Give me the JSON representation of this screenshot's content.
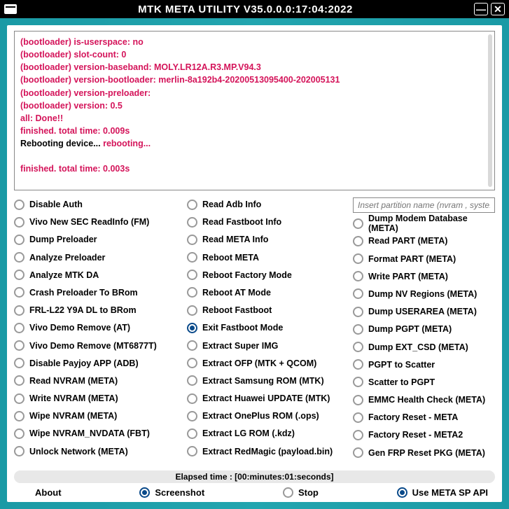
{
  "titlebar": {
    "title": "MTK META UTILITY V35.0.0.0:17:04:2022"
  },
  "log": {
    "lines": [
      {
        "cls": "log-red",
        "text": "(bootloader) is-userspace: no"
      },
      {
        "cls": "log-red",
        "text": "(bootloader) slot-count: 0"
      },
      {
        "cls": "log-red",
        "text": "(bootloader) version-baseband: MOLY.LR12A.R3.MP.V94.3"
      },
      {
        "cls": "log-red",
        "text": "(bootloader) version-bootloader: merlin-8a192b4-20200513095400-202005131"
      },
      {
        "cls": "log-red",
        "text": "(bootloader) version-preloader:"
      },
      {
        "cls": "log-red",
        "text": "(bootloader) version: 0.5"
      },
      {
        "cls": "log-red",
        "text": "all: Done!!"
      },
      {
        "cls": "log-red",
        "text": "finished. total time: 0.009s"
      },
      {
        "cls": "log-black",
        "prefix": "Rebooting device... ",
        "suffix_cls": "log-red",
        "suffix": "rebooting..."
      },
      {
        "cls": "",
        "text": " "
      },
      {
        "cls": "log-red",
        "text": "finished. total time: 0.003s"
      }
    ]
  },
  "input": {
    "placeholder": "Insert partition name (nvram , syste..."
  },
  "cols": {
    "c1": [
      "Disable Auth",
      "Vivo New SEC ReadInfo (FM)",
      "Dump Preloader",
      "Analyze Preloader",
      "Analyze MTK DA",
      "Crash Preloader To BRom",
      "FRL-L22 Y9A DL to BRom",
      "Vivo Demo Remove (AT)",
      "Vivo Demo Remove (MT6877T)",
      "Disable Payjoy APP (ADB)",
      "Read NVRAM (META)",
      "Write NVRAM (META)",
      "Wipe NVRAM (META)",
      "Wipe NVRAM_NVDATA (FBT)",
      "Unlock Network (META)"
    ],
    "c2": [
      "Read Adb Info",
      "Read Fastboot Info",
      "Read META Info",
      "Reboot META",
      "Reboot Factory Mode",
      "Reboot AT Mode",
      "Reboot Fastboot",
      "Exit Fastboot Mode",
      "Extract Super IMG",
      "Extract OFP (MTK + QCOM)",
      "Extract Samsung ROM (MTK)",
      "Extract Huawei UPDATE (MTK)",
      "Extract OnePlus ROM (.ops)",
      "Extract LG ROM (.kdz)",
      "Extract RedMagic (payload.bin)"
    ],
    "c2_checked": 7,
    "c3": [
      "Dump Modem Database (META)",
      "Read PART (META)",
      "Format PART (META)",
      "Write PART (META)",
      "Dump NV Regions (META)",
      "Dump USERAREA (META)",
      "Dump PGPT (META)",
      "Dump  EXT_CSD (META)",
      "PGPT to Scatter",
      "Scatter to PGPT",
      "EMMC Health Check (META)",
      "Factory Reset - META",
      "Factory Reset - META2",
      "Gen FRP Reset PKG (META)"
    ]
  },
  "status": "Elapsed time : [00:minutes:01:seconds]",
  "bottom": {
    "about": "About",
    "screenshot": "Screenshot",
    "stop": "Stop",
    "meta_api": "Use META SP API"
  }
}
